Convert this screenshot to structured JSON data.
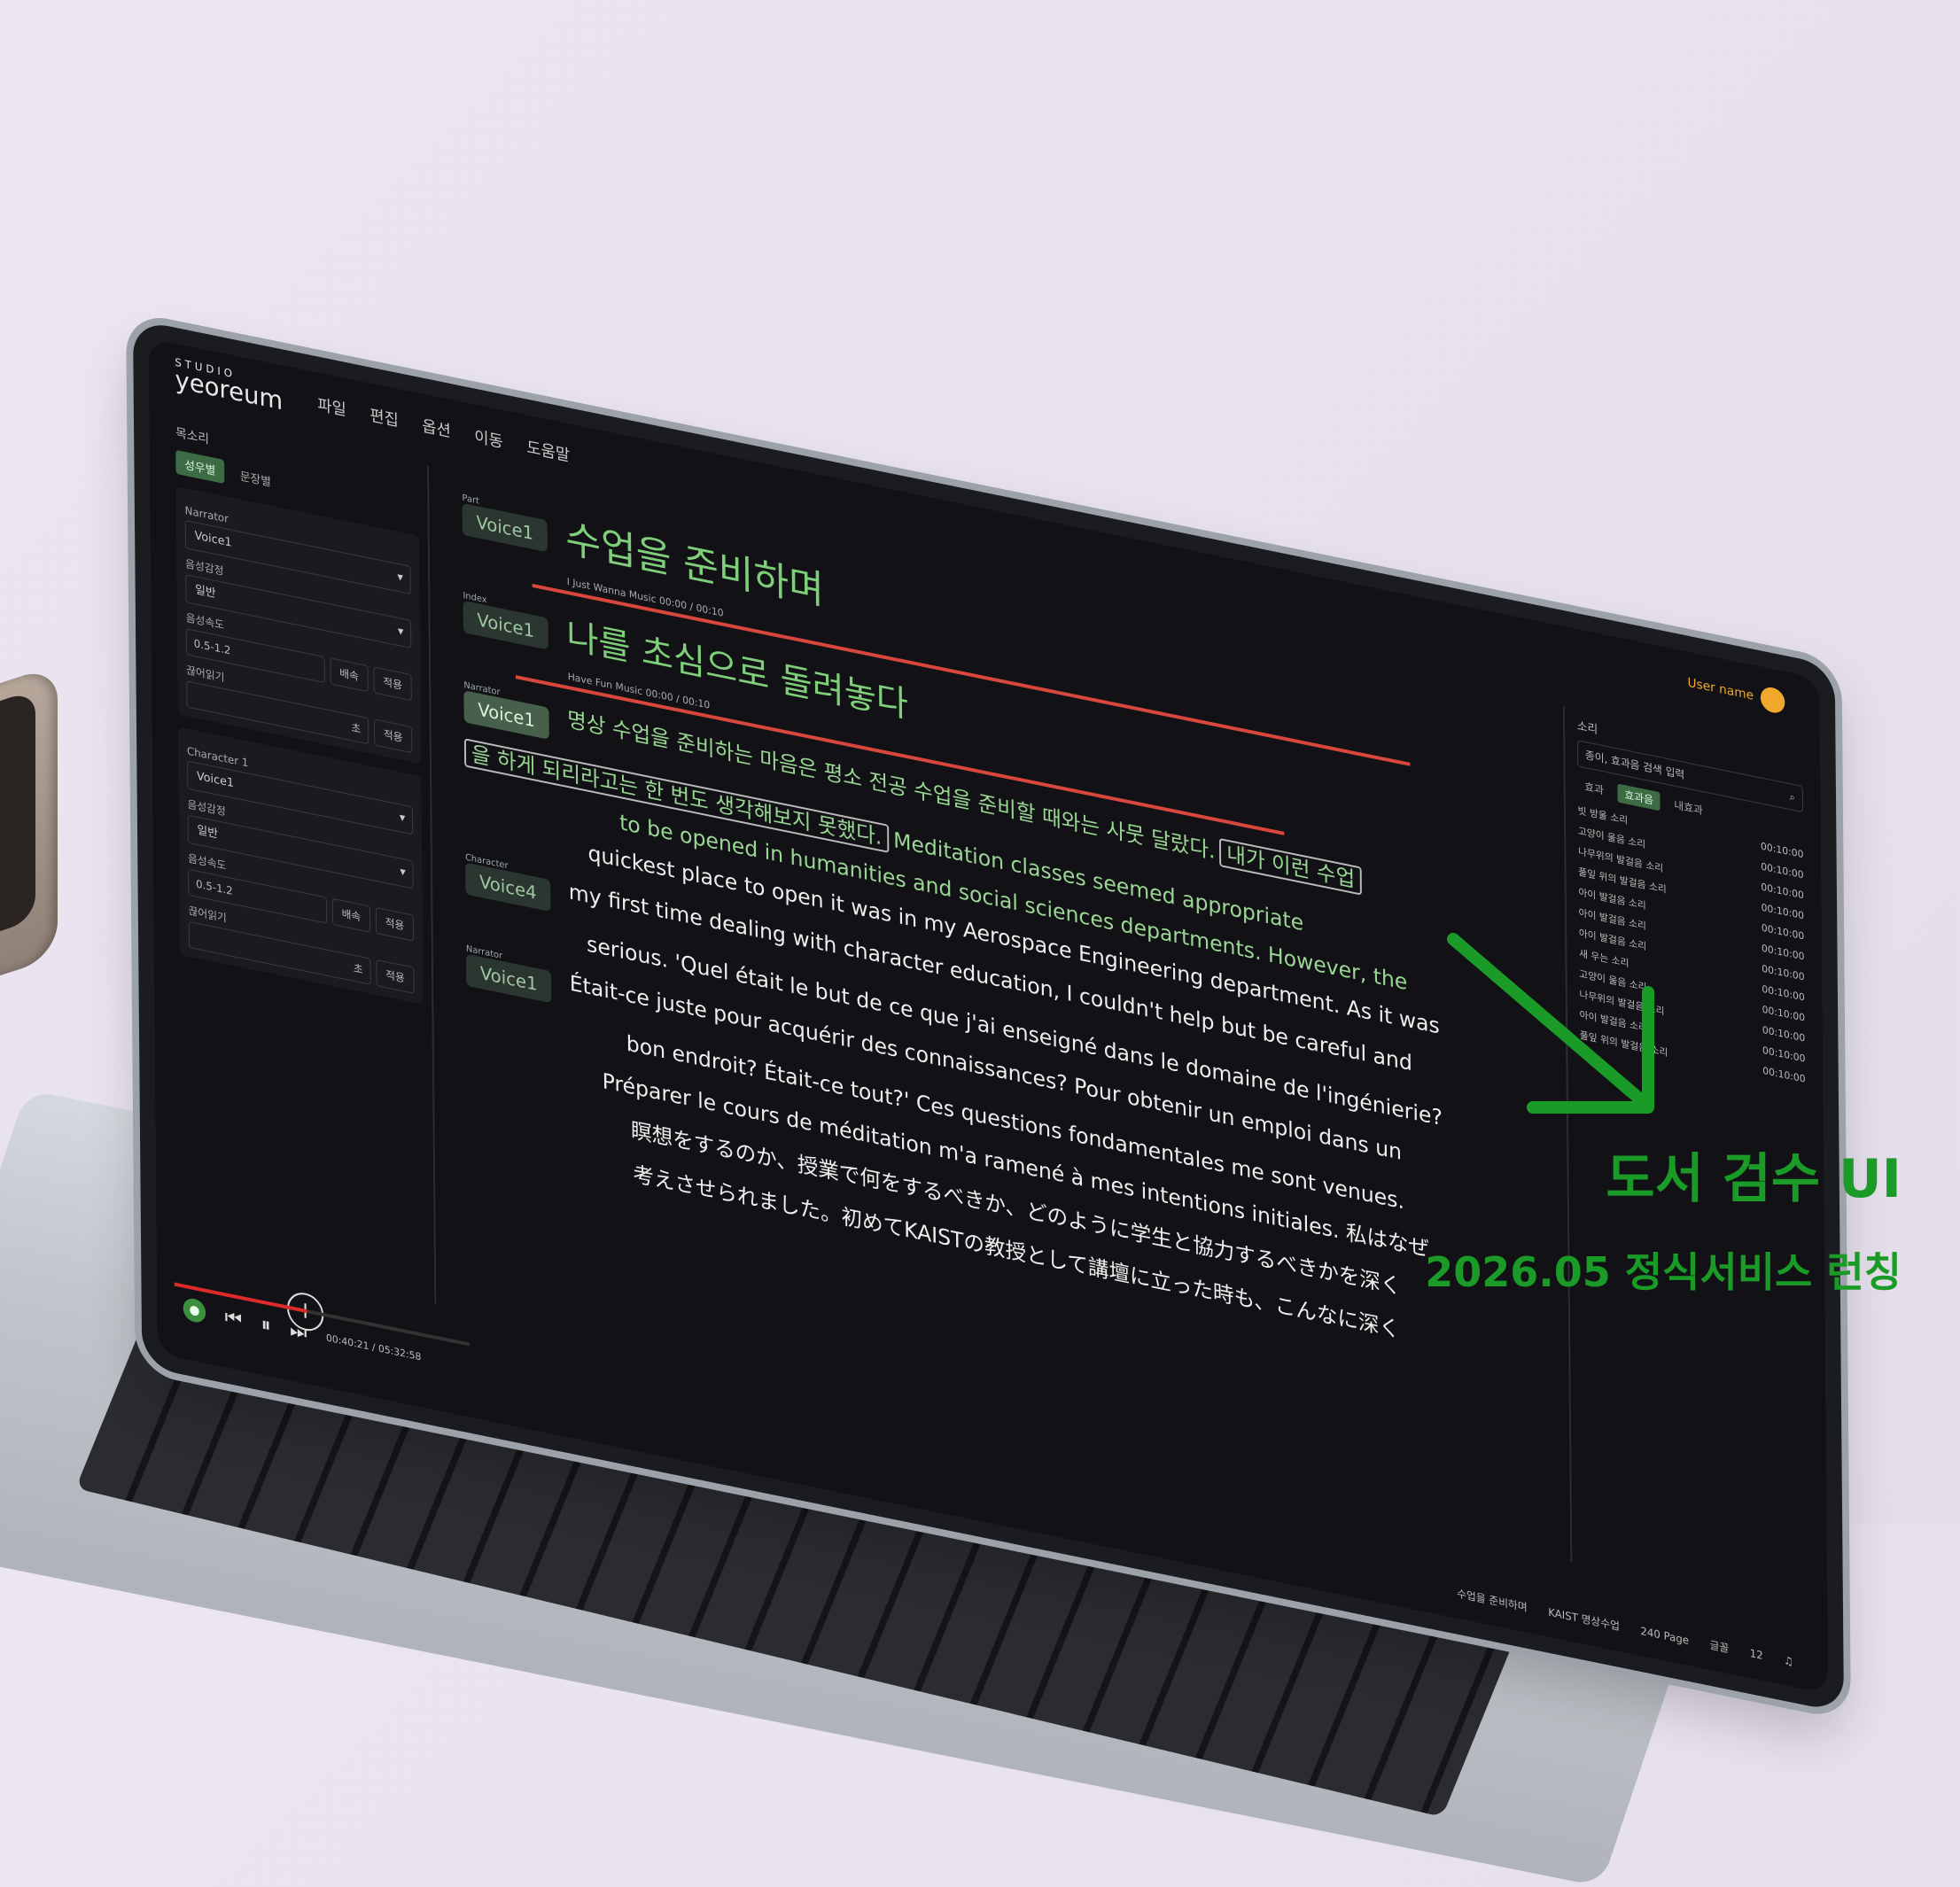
{
  "app": {
    "logo_studio": "STUDIO",
    "logo_name": "yeoreum",
    "menu": [
      "파일",
      "편집",
      "옵션",
      "이동",
      "도움말"
    ],
    "user_name": "User name"
  },
  "sidebar": {
    "title": "목소리",
    "segments": [
      "성우별",
      "문장별"
    ],
    "narrator": {
      "label": "Narrator",
      "voice": "Voice1",
      "emotion_label": "음성감정",
      "emotion_value": "일반",
      "speed_label": "음성속도",
      "speed_range": "0.5-1.2",
      "speed_unit": "배속",
      "apply": "적용",
      "pause_label": "끊어읽기",
      "pause_unit": "초",
      "pause_apply": "적용"
    },
    "character1": {
      "label": "Character 1",
      "voice": "Voice1",
      "emotion_label": "음성감정",
      "emotion_value": "일반",
      "speed_label": "음성속도",
      "speed_range": "0.5-1.2",
      "speed_unit": "배속",
      "apply": "적용",
      "pause_label": "끊어읽기",
      "pause_unit": "초",
      "pause_apply": "적용"
    }
  },
  "editor": {
    "part": {
      "tag": "Part",
      "voice": "Voice1",
      "text": "수업을 준비하며",
      "sub": "I Just Wanna   Music 00:00 / 00:10"
    },
    "index": {
      "tag": "Index",
      "voice": "Voice1",
      "text": "나를 초심으로 돌려놓다",
      "sub": "Have Fun   Music 00:00 / 00:10"
    },
    "narrator_tag": "Narrator",
    "narrator_voice": "Voice1",
    "para1_a": "명상 수업을 준비하는 마음은 평소 전공 수업을 준비할 때와는 사뭇 달랐다.",
    "para1_b": "내가 이런 수업",
    "para1_c": "을 하게 되리라고는 한 번도 생각해보지 못했다.",
    "para1_d": "Meditation classes seemed appropriate",
    "para1_e": "to be opened in humanities and social sciences departments. However, the",
    "para1_f": "quickest place to open it was in my Aerospace Engineering department. As it was",
    "character_tag": "Character",
    "character_voice": "Voice4",
    "para2_a": "my first time dealing with character education, I couldn't help but be careful and",
    "para2_b": "serious. 'Quel était le but de ce que j'ai enseigné dans le domaine de l'ingénierie?",
    "narrator2_tag": "Narrator",
    "narrator2_voice": "Voice1",
    "para3_a": "Était-ce juste pour acquérir des connaissances? Pour obtenir un emploi dans un",
    "para3_b": "bon endroit? Était-ce tout?' Ces questions fondamentales me sont venues.",
    "para3_c": "Préparer le cours de méditation m'a ramené à mes intentions initiales. 私はなぜ",
    "para3_d": "瞑想をするのか、授業で何をするべきか、どのように学生と協力するべきかを深く",
    "para3_e": "考えさせられました。初めてKAISTの教授として講壇に立った時も、こんなに深く"
  },
  "rightbar": {
    "title": "소리",
    "search_value": "종이, 효과음 검색 입력",
    "tabs": [
      "효과",
      "효과음",
      "내효과"
    ],
    "sounds": [
      {
        "name": "빗 방울 소리",
        "time": "00:10:00"
      },
      {
        "name": "고양이 울음 소리",
        "time": "00:10:00"
      },
      {
        "name": "나무위의 발걸음 소리",
        "time": "00:10:00"
      },
      {
        "name": "풀잎 위의 발걸음 소리",
        "time": "00:10:00"
      },
      {
        "name": "아이 발걸음 소리",
        "time": "00:10:00"
      },
      {
        "name": "아이 발걸음 소리",
        "time": "00:10:00"
      },
      {
        "name": "아이 발걸음 소리",
        "time": "00:10:00"
      },
      {
        "name": "새 우는 소리",
        "time": "00:10:00"
      },
      {
        "name": "고양이 울음 소리",
        "time": "00:10:00"
      },
      {
        "name": "나무위의 발걸음 소리",
        "time": "00:10:00"
      },
      {
        "name": "아이 발걸음 소리",
        "time": "00:10:00"
      },
      {
        "name": "풀잎 위의 발걸음 소리",
        "time": "00:10:00"
      }
    ]
  },
  "player": {
    "progress": 0.45,
    "time": "00:40:21 / 05:32:58"
  },
  "status": {
    "chapter": "수업을 준비하며",
    "book": "KAIST 명상수업",
    "page": "240 Page",
    "misc1": "글꼴",
    "misc2": "12"
  },
  "caption": {
    "title": "도서 검수 UI",
    "subtitle": "2026.05 정식서비스 런칭"
  },
  "colors": {
    "accent_green": "#1a9a26",
    "editor_green": "#7fcf7a",
    "highlight_red": "#d9473c",
    "progress_red": "#e02a2a"
  }
}
